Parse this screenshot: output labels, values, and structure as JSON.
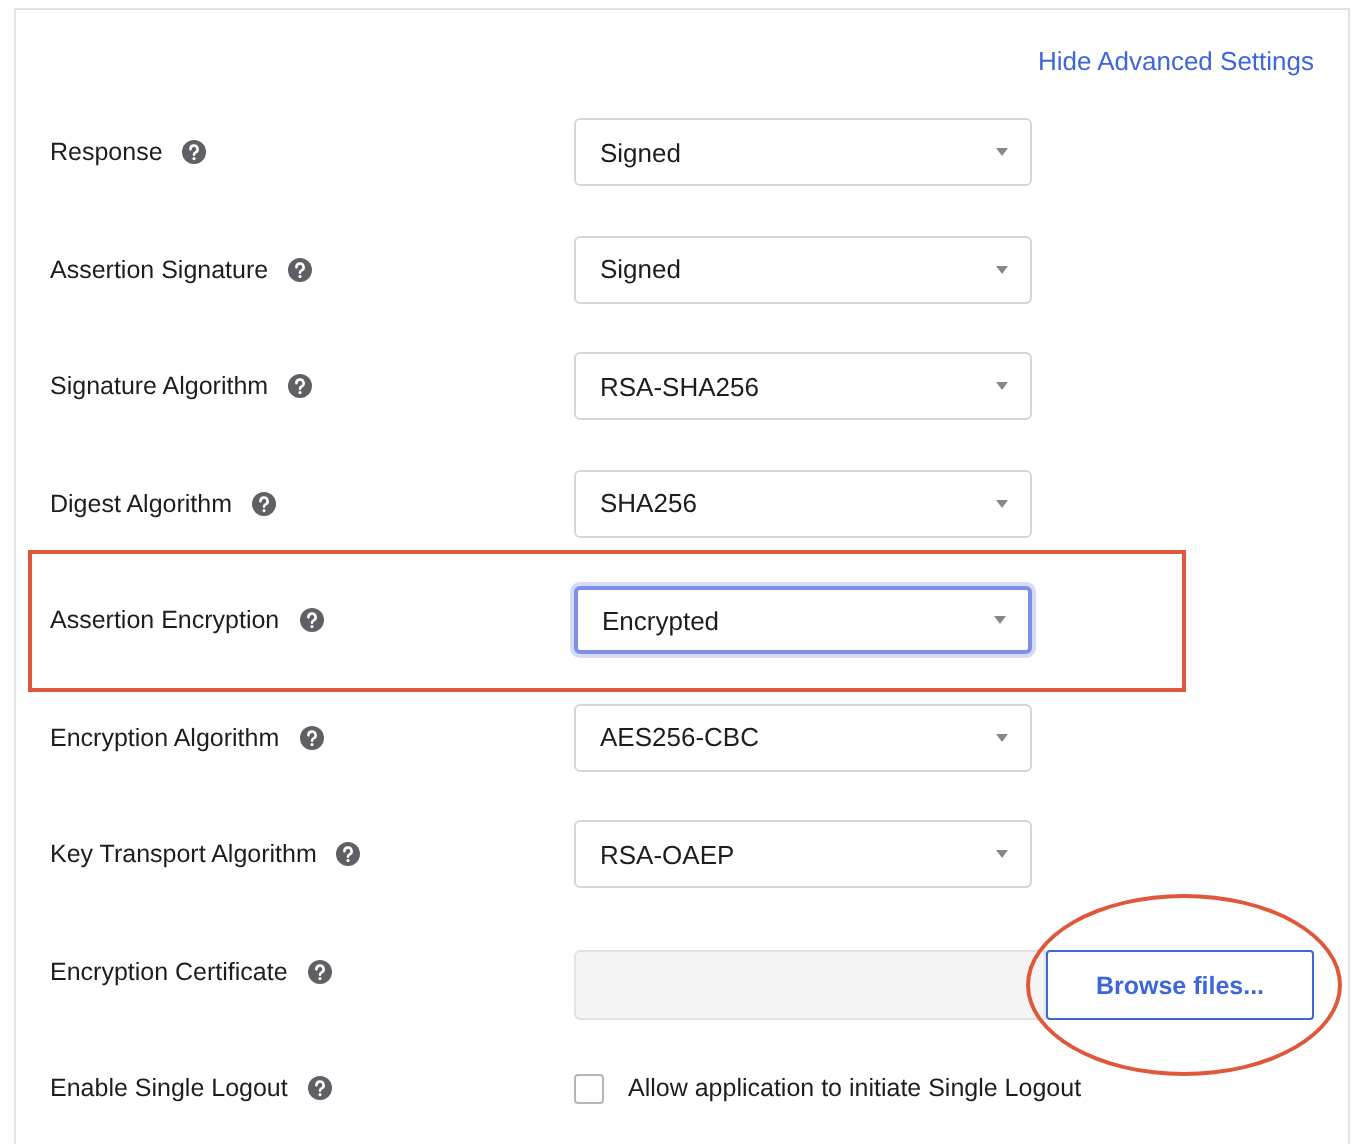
{
  "link": "Hide Advanced Settings",
  "rows": [
    {
      "kind": "select",
      "label": "Response",
      "value": "Signed",
      "focused": false,
      "marked": false
    },
    {
      "kind": "select",
      "label": "Assertion Signature",
      "value": "Signed",
      "focused": false,
      "marked": false
    },
    {
      "kind": "select",
      "label": "Signature Algorithm",
      "value": "RSA-SHA256",
      "focused": false,
      "marked": false
    },
    {
      "kind": "select",
      "label": "Digest Algorithm",
      "value": "SHA256",
      "focused": false,
      "marked": false
    },
    {
      "kind": "select",
      "label": "Assertion Encryption",
      "value": "Encrypted",
      "focused": true,
      "marked": true
    },
    {
      "kind": "select",
      "label": "Encryption Algorithm",
      "value": "AES256-CBC",
      "focused": false,
      "marked": false
    },
    {
      "kind": "select",
      "label": "Key Transport Algorithm",
      "value": "RSA-OAEP",
      "focused": false,
      "marked": false
    },
    {
      "kind": "file",
      "label": "Encryption Certificate",
      "button": "Browse files...",
      "marked": true
    },
    {
      "kind": "checkbox",
      "label": "Enable Single Logout",
      "option": "Allow application to initiate Single Logout",
      "checked": false,
      "marked": false
    }
  ]
}
